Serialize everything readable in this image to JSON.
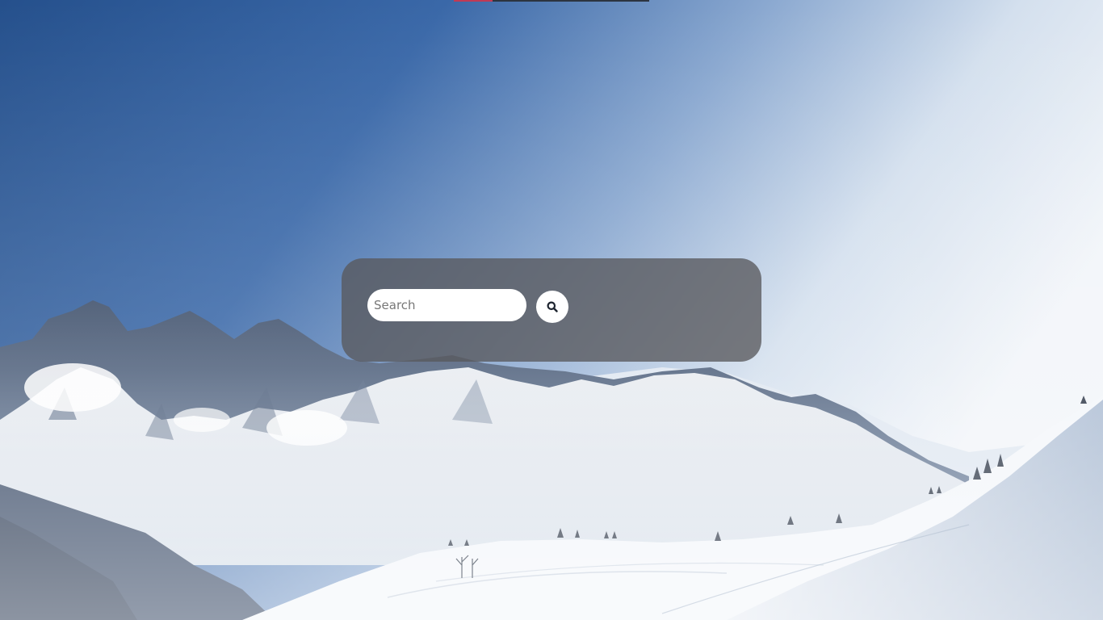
{
  "search": {
    "placeholder": "Search",
    "value": "",
    "button_icon": "search-icon"
  },
  "background": {
    "scene": "snowy-mountain-landscape",
    "sky_top_color": "#2a5590",
    "sky_light_color": "#eef3f8",
    "snow_color": "#f1f4f8"
  },
  "top_bar": {
    "accent_color": "#c03a55",
    "bar_color": "#2c3440"
  },
  "panel": {
    "color": "#58585c"
  }
}
